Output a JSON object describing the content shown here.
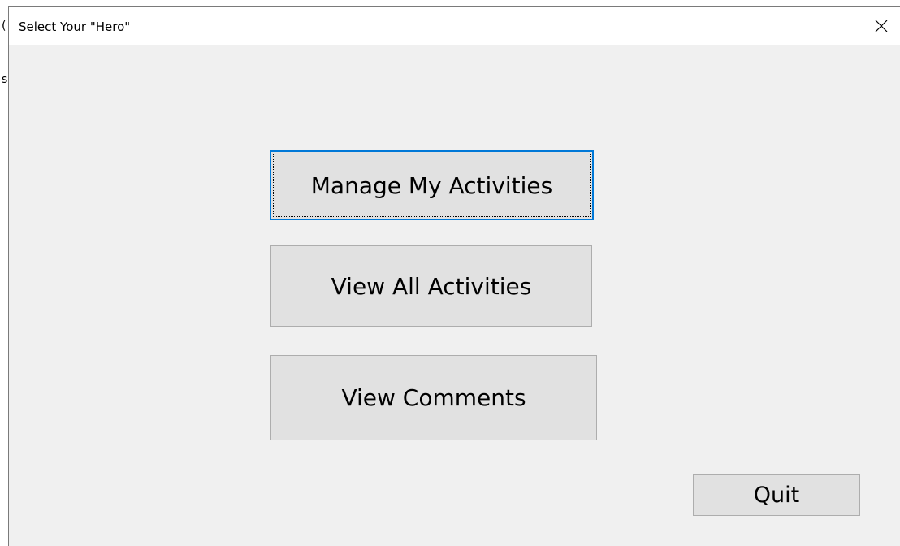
{
  "window": {
    "title": "Select Your \"Hero\"",
    "close_icon": "close-icon"
  },
  "buttons": {
    "manage_label": "Manage My Activities",
    "view_all_label": "View All Activities",
    "comments_label": "View Comments",
    "quit_label": "Quit"
  },
  "colors": {
    "focus_border": "#0078d7",
    "button_bg": "#e1e1e1",
    "window_bg": "#f0f0f0"
  }
}
